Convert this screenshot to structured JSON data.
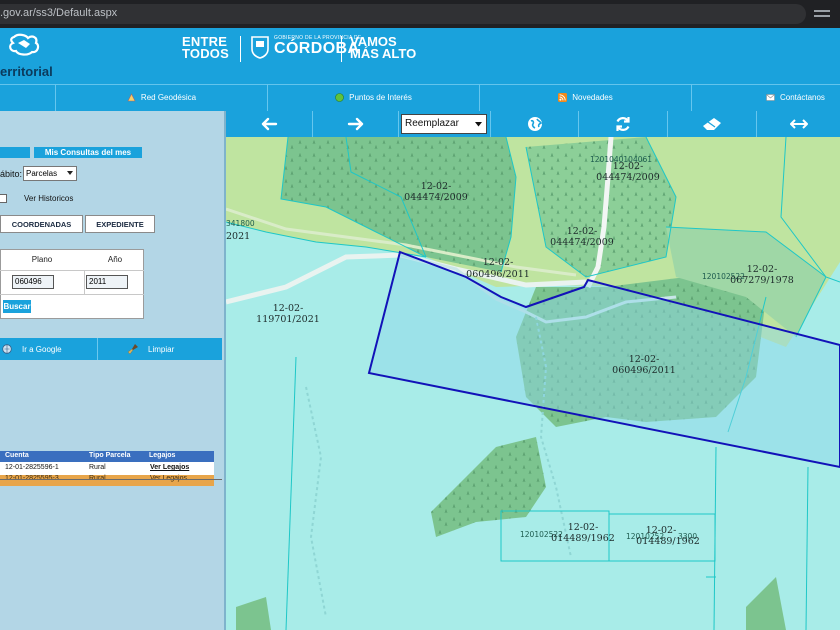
{
  "browser": {
    "url": ".gov.ar/ss3/Default.aspx"
  },
  "header": {
    "title": "erritorial",
    "brand_entre_line1": "ENTRE",
    "brand_entre_line2": "TODOS",
    "brand_gob": "GOBIERNO DE LA PROVINCIA DE",
    "brand_cordoba": "CÓRDOBA",
    "brand_vamos_line1": "VAMOS",
    "brand_vamos_line2": "MÁS ALTO"
  },
  "nav": {
    "items": [
      {
        "label": "Red Geodésica",
        "icon": "geodesic-icon"
      },
      {
        "label": "Puntos de Interés",
        "icon": "poi-icon"
      },
      {
        "label": "Novedades",
        "icon": "rss-icon"
      },
      {
        "label": "Contáctanos",
        "icon": "mail-icon"
      }
    ]
  },
  "sidebar": {
    "tab_consultas": "Mis Consultas del mes",
    "ambito_label": "ábito:",
    "ambito_value": "Parcelas",
    "historicos_label": "Ver Historicos",
    "btn_coordenadas": "COORDENADAS",
    "btn_expediente": "EXPEDIENTE",
    "form": {
      "plano_header": "Plano",
      "anio_header": "Año",
      "plano_value": "060496",
      "anio_value": "2011",
      "buscar_label": "Buscar"
    },
    "actions": {
      "google_label": "Ir a Google",
      "limpiar_label": "Limpiar"
    },
    "results": {
      "headers": {
        "cuenta": "Cuenta",
        "tipo": "Tipo Parcela",
        "legajos": "Legajos"
      },
      "rows": [
        {
          "cuenta": "12-01-2825596-1",
          "tipo": "Rural",
          "legajos": "Ver Legajos"
        },
        {
          "cuenta": "12-01-2825595-3",
          "tipo": "Rural",
          "legajos": "Ver Legajos"
        }
      ]
    }
  },
  "toolbar": {
    "back_icon": "arrow-left-icon",
    "forward_icon": "arrow-right-icon",
    "mode_value": "Reemplazar",
    "globe_icon": "globe-icon",
    "refresh_icon": "refresh-icon",
    "eraser_icon": "eraser-icon",
    "measure_icon": "measure-icon"
  },
  "map": {
    "labels": {
      "a_top": "12-02-",
      "a_bot": "044474/2009",
      "b_top": "12-02-",
      "b_bot": "044474/2009",
      "c_top": "12-02-",
      "c_bot": "044474/2009",
      "d_top": "12-02-",
      "d_bot": "060496/2011",
      "e_top": "12-02-",
      "e_bot": "067279/1978",
      "f_top": "12-02-",
      "f_bot": "119701/2021",
      "g_top": "12-02-",
      "g_bot": "060496/2011",
      "h_top": "12-02-",
      "h_bot": "014489/1962",
      "i_top": "12-02-",
      "i_bot": "014489/1962",
      "edge_code": "341800",
      "edge_year": "2021"
    },
    "codes": {
      "c1": "1201040104061",
      "c2": "120102522",
      "c3": "120102522",
      "c4": "12010252",
      "c5": "3300"
    },
    "colors": {
      "base": "#a8ece8",
      "forest": "#7cc48f",
      "light_green": "#bfe4a0",
      "selection": "#1212b8"
    }
  }
}
